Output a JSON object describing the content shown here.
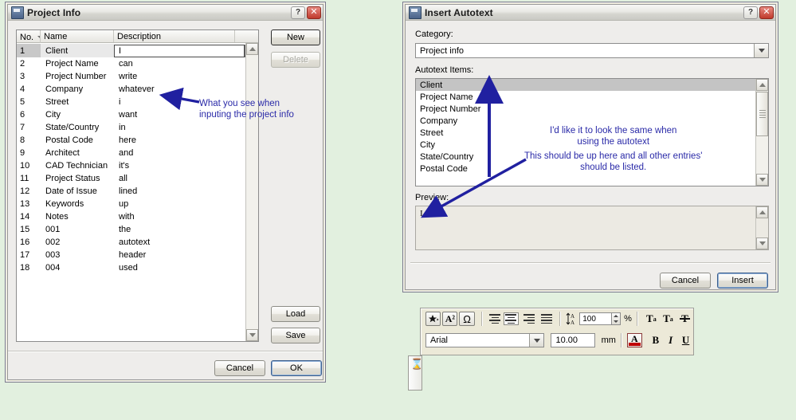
{
  "background_color": "#e2f0df",
  "annotation_color": "#2a2aa8",
  "project_dialog": {
    "title": "Project Info",
    "help_label": "?",
    "close_label": "✕",
    "grid": {
      "columns": [
        "No.",
        "Name",
        "Description"
      ],
      "rows": [
        {
          "no": "1",
          "name": "Client",
          "desc": "I"
        },
        {
          "no": "2",
          "name": "Project Name",
          "desc": "can"
        },
        {
          "no": "3",
          "name": "Project Number",
          "desc": "write"
        },
        {
          "no": "4",
          "name": "Company",
          "desc": "whatever"
        },
        {
          "no": "5",
          "name": "Street",
          "desc": "i"
        },
        {
          "no": "6",
          "name": "City",
          "desc": "want"
        },
        {
          "no": "7",
          "name": "State/Country",
          "desc": "in"
        },
        {
          "no": "8",
          "name": "Postal Code",
          "desc": "here"
        },
        {
          "no": "9",
          "name": "Architect",
          "desc": "and"
        },
        {
          "no": "10",
          "name": "CAD Technician",
          "desc": "it's"
        },
        {
          "no": "11",
          "name": "Project Status",
          "desc": "all"
        },
        {
          "no": "12",
          "name": "Date of Issue",
          "desc": "lined"
        },
        {
          "no": "13",
          "name": "Keywords",
          "desc": "up"
        },
        {
          "no": "14",
          "name": "Notes",
          "desc": "with"
        },
        {
          "no": "15",
          "name": "001",
          "desc": "the"
        },
        {
          "no": "16",
          "name": "002",
          "desc": "autotext"
        },
        {
          "no": "17",
          "name": "003",
          "desc": "header"
        },
        {
          "no": "18",
          "name": "004",
          "desc": "used"
        }
      ]
    },
    "buttons": {
      "new": "New",
      "delete": "Delete",
      "load": "Load",
      "save": "Save",
      "cancel": "Cancel",
      "ok": "OK"
    },
    "annotation": "What you see when\ninputing the project info"
  },
  "autotext_dialog": {
    "title": "Insert Autotext",
    "help_label": "?",
    "close_label": "✕",
    "category_label": "Category:",
    "category_value": "Project info",
    "items_label": "Autotext Items:",
    "items": [
      "Client",
      "Project Name",
      "Project Number",
      "Company",
      "Street",
      "City",
      "State/Country",
      "Postal Code"
    ],
    "selected_item": "Client",
    "preview_label": "Preview:",
    "preview_value": "I",
    "buttons": {
      "cancel": "Cancel",
      "insert": "Insert"
    },
    "annotation_1": "I'd like it to look the same when\nusing the autotext",
    "annotation_2": "This should be up here and all other entries'\nshould be listed."
  },
  "format_toolbar": {
    "icons": {
      "symbol_star": "star-symbol-icon",
      "char_scale": "A²",
      "omega": "Ω",
      "align_left": "align-left-icon",
      "align_center": "align-center-icon",
      "align_right": "align-right-icon",
      "align_justify": "align-justify-icon",
      "line_spacing": "line-spacing-icon",
      "superscript": "T",
      "superscript_sup": "a",
      "subscript": "T",
      "subscript_sub": "a",
      "strikethrough": "T",
      "font_color": "A",
      "bold": "B",
      "italic": "I",
      "underline": "U"
    },
    "scale_value": "100",
    "scale_unit": "%",
    "font_name": "Arial",
    "font_size": "10.00",
    "size_unit": "mm",
    "active_alignment": "align-center"
  },
  "busy_indicator": {
    "cursor": "⌛",
    "name": "hourglass-cursor"
  }
}
